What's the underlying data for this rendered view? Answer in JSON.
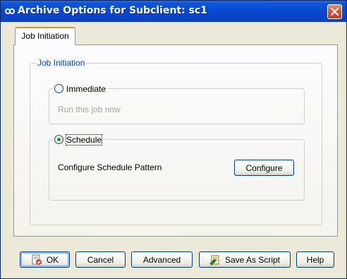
{
  "window": {
    "title": "Archive Options for Subclient: sc1",
    "title_bar_color": "#0a55dc",
    "app_icon": "link-chain-icon",
    "close_icon": "close-icon"
  },
  "tabs": [
    {
      "label": "Job Initiation",
      "selected": true
    }
  ],
  "job_initiation": {
    "group_title": "Job Initiation",
    "immediate": {
      "label": "Immediate",
      "selected": false,
      "description": "Run this job now"
    },
    "schedule": {
      "label": "Schedule",
      "selected": true,
      "description": "Configure Schedule Pattern",
      "configure_label": "Configure"
    }
  },
  "buttons": {
    "ok": {
      "label": "OK",
      "icon": "ok-check-icon"
    },
    "cancel": {
      "label": "Cancel"
    },
    "advanced": {
      "label": "Advanced"
    },
    "save_as_script": {
      "label": "Save As Script",
      "icon": "script-icon"
    },
    "help": {
      "label": "Help"
    }
  }
}
